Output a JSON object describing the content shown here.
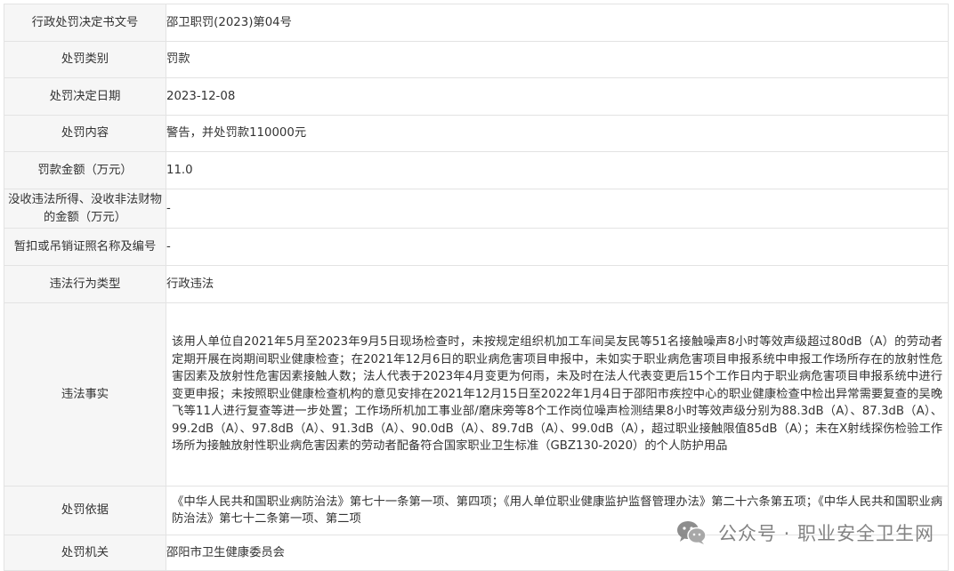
{
  "rows": [
    {
      "label": "行政处罚决定书文号",
      "value": "邵卫职罚(2023)第04号"
    },
    {
      "label": "处罚类别",
      "value": "罚款"
    },
    {
      "label": "处罚决定日期",
      "value": "2023-12-08"
    },
    {
      "label": "处罚内容",
      "value": "警告，并处罚款110000元"
    },
    {
      "label": "罚款金额（万元）",
      "value": "11.0"
    },
    {
      "label": "没收违法所得、没收非法财物的金额（万元）",
      "value": "-"
    },
    {
      "label": "暂扣或吊销证照名称及编号",
      "value": "-"
    },
    {
      "label": "违法行为类型",
      "value": "行政违法"
    },
    {
      "label": "违法事实",
      "value": "该用人单位自2021年5月至2023年9月5日现场检查时，未按规定组织机加工车间吴友民等51名接触噪声8小时等效声级超过80dB（A）的劳动者定期开展在岗期间职业健康检查；在2021年12月6日的职业病危害项目申报中，未如实于职业病危害项目申报系统中申报工作场所存在的放射性危害因素及放射性危害因素接触人数；法人代表于2023年4月变更为何雨，未及时在法人代表变更后15个工作日内于职业病危害项目申报系统中进行变更申报；未按照职业健康检查机构的意见安排在2021年12月15日至2022年1月4日于邵阳市疾控中心的职业健康检查中检出异常需要复查的吴晚飞等11人进行复查等进一步处置；工作场所机加工事业部/磨床旁等8个工作岗位噪声检测结果8小时等效声级分别为88.3dB（A）、87.3dB（A）、99.2dB（A）、97.8dB（A）、91.3dB（A）、90.0dB（A）、89.7dB（A）、99.0dB（A），超过职业接触限值85dB（A）；未在X射线探伤检验工作场所为接触放射性职业病危害因素的劳动者配备符合国家职业卫生标准（GBZ130-2020）的个人防护用品"
    },
    {
      "label": "处罚依据",
      "value": "《中华人民共和国职业病防治法》第七十一条第一项、第四项；《用人单位职业健康监护监督管理办法》第二十六条第五项；《中华人民共和国职业病防治法》第七十二条第一项、第二项"
    },
    {
      "label": "处罚机关",
      "value": "邵阳市卫生健康委员会"
    }
  ],
  "watermark": {
    "icon": "wechat-icon",
    "text": "公众号 · 职业安全卫生网"
  }
}
